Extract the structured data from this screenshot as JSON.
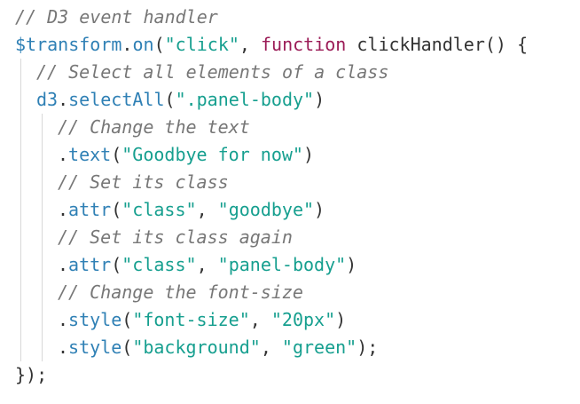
{
  "code_lines": [
    {
      "indent": 0,
      "tokens": [
        {
          "t": "// D3 event handler",
          "k": "comment"
        }
      ]
    },
    {
      "indent": 0,
      "tokens": [
        {
          "t": "$transform",
          "k": "var"
        },
        {
          "t": ".",
          "k": "punc"
        },
        {
          "t": "on",
          "k": "method"
        },
        {
          "t": "(",
          "k": "punc"
        },
        {
          "t": "\"click\"",
          "k": "str"
        },
        {
          "t": ", ",
          "k": "punc"
        },
        {
          "t": "function",
          "k": "kw"
        },
        {
          "t": " clickHandler",
          "k": "fn"
        },
        {
          "t": "() {",
          "k": "punc"
        }
      ]
    },
    {
      "indent": 1,
      "tokens": [
        {
          "t": "// Select all elements of a class",
          "k": "comment"
        }
      ]
    },
    {
      "indent": 1,
      "tokens": [
        {
          "t": "d3",
          "k": "var"
        },
        {
          "t": ".",
          "k": "punc"
        },
        {
          "t": "selectAll",
          "k": "method"
        },
        {
          "t": "(",
          "k": "punc"
        },
        {
          "t": "\".panel-body\"",
          "k": "str"
        },
        {
          "t": ")",
          "k": "punc"
        }
      ]
    },
    {
      "indent": 2,
      "tokens": [
        {
          "t": "// Change the text",
          "k": "comment"
        }
      ]
    },
    {
      "indent": 2,
      "tokens": [
        {
          "t": ".",
          "k": "punc"
        },
        {
          "t": "text",
          "k": "method"
        },
        {
          "t": "(",
          "k": "punc"
        },
        {
          "t": "\"Goodbye for now\"",
          "k": "str"
        },
        {
          "t": ")",
          "k": "punc"
        }
      ]
    },
    {
      "indent": 2,
      "tokens": [
        {
          "t": "// Set its class",
          "k": "comment"
        }
      ]
    },
    {
      "indent": 2,
      "tokens": [
        {
          "t": ".",
          "k": "punc"
        },
        {
          "t": "attr",
          "k": "method"
        },
        {
          "t": "(",
          "k": "punc"
        },
        {
          "t": "\"class\"",
          "k": "str"
        },
        {
          "t": ", ",
          "k": "punc"
        },
        {
          "t": "\"goodbye\"",
          "k": "str"
        },
        {
          "t": ")",
          "k": "punc"
        }
      ]
    },
    {
      "indent": 2,
      "tokens": [
        {
          "t": "// Set its class again",
          "k": "comment"
        }
      ]
    },
    {
      "indent": 2,
      "tokens": [
        {
          "t": ".",
          "k": "punc"
        },
        {
          "t": "attr",
          "k": "method"
        },
        {
          "t": "(",
          "k": "punc"
        },
        {
          "t": "\"class\"",
          "k": "str"
        },
        {
          "t": ", ",
          "k": "punc"
        },
        {
          "t": "\"panel-body\"",
          "k": "str"
        },
        {
          "t": ")",
          "k": "punc"
        }
      ]
    },
    {
      "indent": 2,
      "tokens": [
        {
          "t": "// Change the font-size",
          "k": "comment"
        }
      ]
    },
    {
      "indent": 2,
      "tokens": [
        {
          "t": ".",
          "k": "punc"
        },
        {
          "t": "style",
          "k": "method"
        },
        {
          "t": "(",
          "k": "punc"
        },
        {
          "t": "\"font-size\"",
          "k": "str"
        },
        {
          "t": ", ",
          "k": "punc"
        },
        {
          "t": "\"20px\"",
          "k": "str"
        },
        {
          "t": ")",
          "k": "punc"
        }
      ]
    },
    {
      "indent": 2,
      "tokens": [
        {
          "t": ".",
          "k": "punc"
        },
        {
          "t": "style",
          "k": "method"
        },
        {
          "t": "(",
          "k": "punc"
        },
        {
          "t": "\"background\"",
          "k": "str"
        },
        {
          "t": ", ",
          "k": "punc"
        },
        {
          "t": "\"green\"",
          "k": "str"
        },
        {
          "t": ");",
          "k": "punc"
        }
      ]
    },
    {
      "indent": 0,
      "tokens": [
        {
          "t": "});",
          "k": "punc"
        }
      ]
    }
  ],
  "colors": {
    "background": "#ffffff",
    "comment": "#777777",
    "identifier": "#2f80b5",
    "string": "#169f8f",
    "keyword": "#9b1c57",
    "plain": "#333333",
    "indent_guide": "#d8d8d8"
  }
}
